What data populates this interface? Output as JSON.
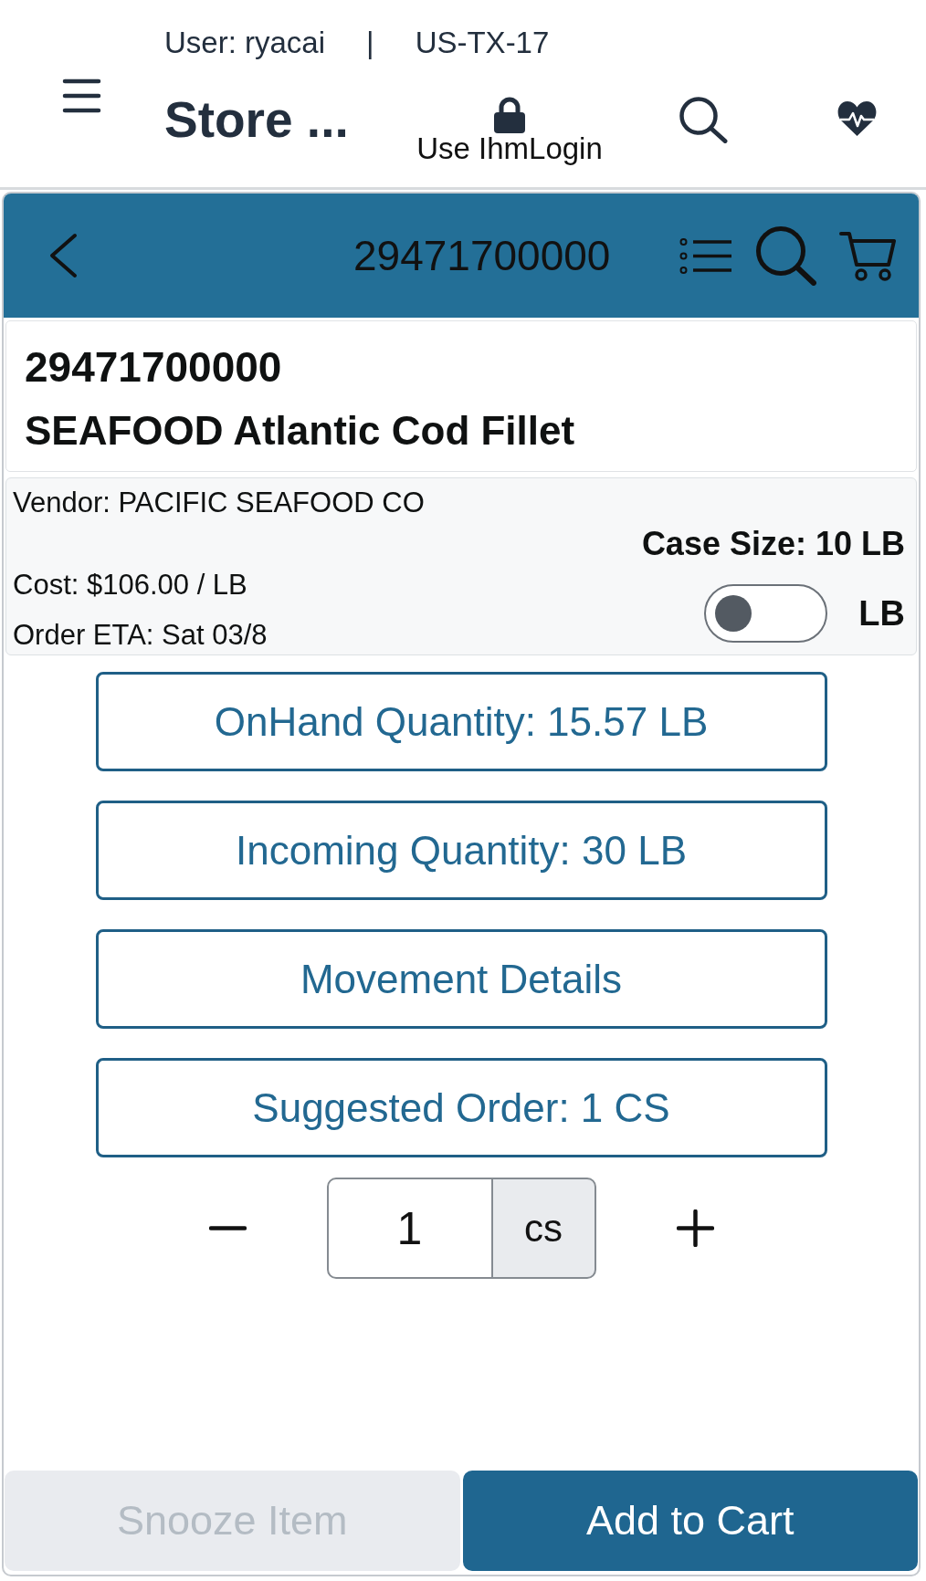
{
  "header": {
    "user": "User: ryacai",
    "separator": "|",
    "store_id": "US-TX-17",
    "title": "Store ...",
    "login_label": "Use IhmLogin"
  },
  "nav_bar": {
    "title": "29471700000"
  },
  "product": {
    "item_number": "29471700000",
    "name": "SEAFOOD Atlantic Cod Fillet"
  },
  "details": {
    "vendor": "Vendor: PACIFIC SEAFOOD CO",
    "cost": "Cost: $106.00 / LB",
    "order_eta": "Order ETA: Sat 03/8",
    "case_size": "Case Size: 10 LB",
    "unit_toggle": {
      "on": false,
      "label": "LB"
    }
  },
  "info_buttons": [
    {
      "label": "OnHand Quantity: 15.57 LB"
    },
    {
      "label": "Incoming Quantity: 30 LB"
    },
    {
      "label": "Movement Details"
    },
    {
      "label": "Suggested Order: 1 CS"
    }
  ],
  "quantity": {
    "value": "1",
    "unit": "cs"
  },
  "actions": [
    {
      "label": "Snooze Item",
      "disabled": true
    },
    {
      "label": "Add to Cart",
      "disabled": false
    }
  ]
}
